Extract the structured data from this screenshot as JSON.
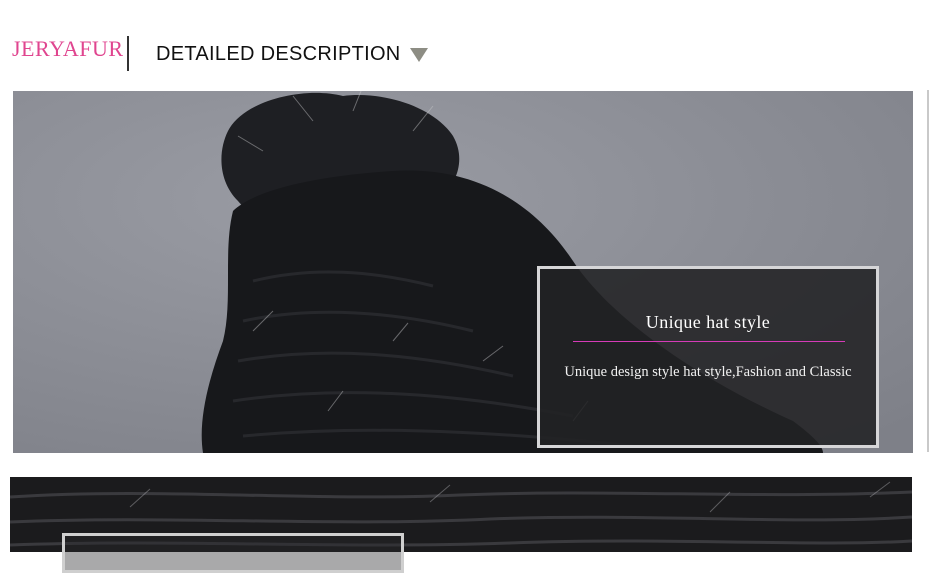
{
  "header": {
    "brand": "JERYAFUR",
    "section_title": "DETAILED DESCRIPTION",
    "dropdown_icon": "triangle-down-icon"
  },
  "feature": {
    "title": "Unique hat style",
    "description": "Unique design style hat style,Fashion and Classic"
  },
  "colors": {
    "brand": "#e0458f",
    "underline": "#d63bb8",
    "callout_background": "#222224",
    "fur": "#1a1a1c",
    "backdrop": "#898b93"
  }
}
